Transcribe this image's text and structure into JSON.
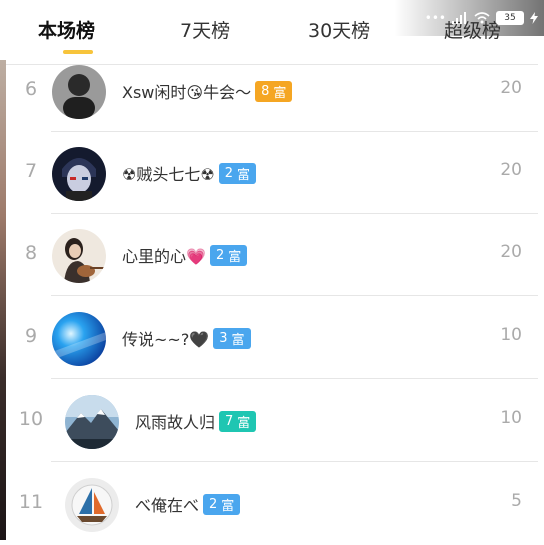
{
  "tabs": [
    {
      "label": "本场榜",
      "active": true
    },
    {
      "label": "7天榜",
      "active": false
    },
    {
      "label": "30天榜",
      "active": false
    },
    {
      "label": "超级榜",
      "active": false
    }
  ],
  "status": {
    "dots": "•••",
    "battery": "35"
  },
  "colors": {
    "accent": "#f7c43b",
    "badge_orange": "#f5a623",
    "badge_blue": "#4aa6ee",
    "badge_teal": "#1fc6b2"
  },
  "rows": [
    {
      "rank": "6",
      "name": "Xsw闲时😘牛会～",
      "badge_level": "8",
      "badge_text": "富",
      "score": "20",
      "badge_color": "orange",
      "avatar": "dark-portrait"
    },
    {
      "rank": "7",
      "name": "☢贼头七七☢",
      "badge_level": "2",
      "badge_text": "富",
      "score": "20",
      "badge_color": "blue",
      "avatar": "anime-boy"
    },
    {
      "rank": "8",
      "name": "心里的心💗",
      "badge_level": "2",
      "badge_text": "富",
      "score": "20",
      "badge_color": "blue",
      "avatar": "girl-guitar"
    },
    {
      "rank": "9",
      "name": "传说~~?🖤",
      "badge_level": "3",
      "badge_text": "富",
      "score": "10",
      "badge_color": "blue",
      "avatar": "blue-abstract"
    },
    {
      "rank": "10",
      "name": "风雨故人归",
      "badge_level": "7",
      "badge_text": "富",
      "score": "10",
      "badge_color": "teal",
      "avatar": "mountain"
    },
    {
      "rank": "11",
      "name": "べ俺在べ",
      "badge_level": "2",
      "badge_text": "富",
      "score": "5",
      "badge_color": "blue",
      "avatar": "sailboat"
    }
  ]
}
